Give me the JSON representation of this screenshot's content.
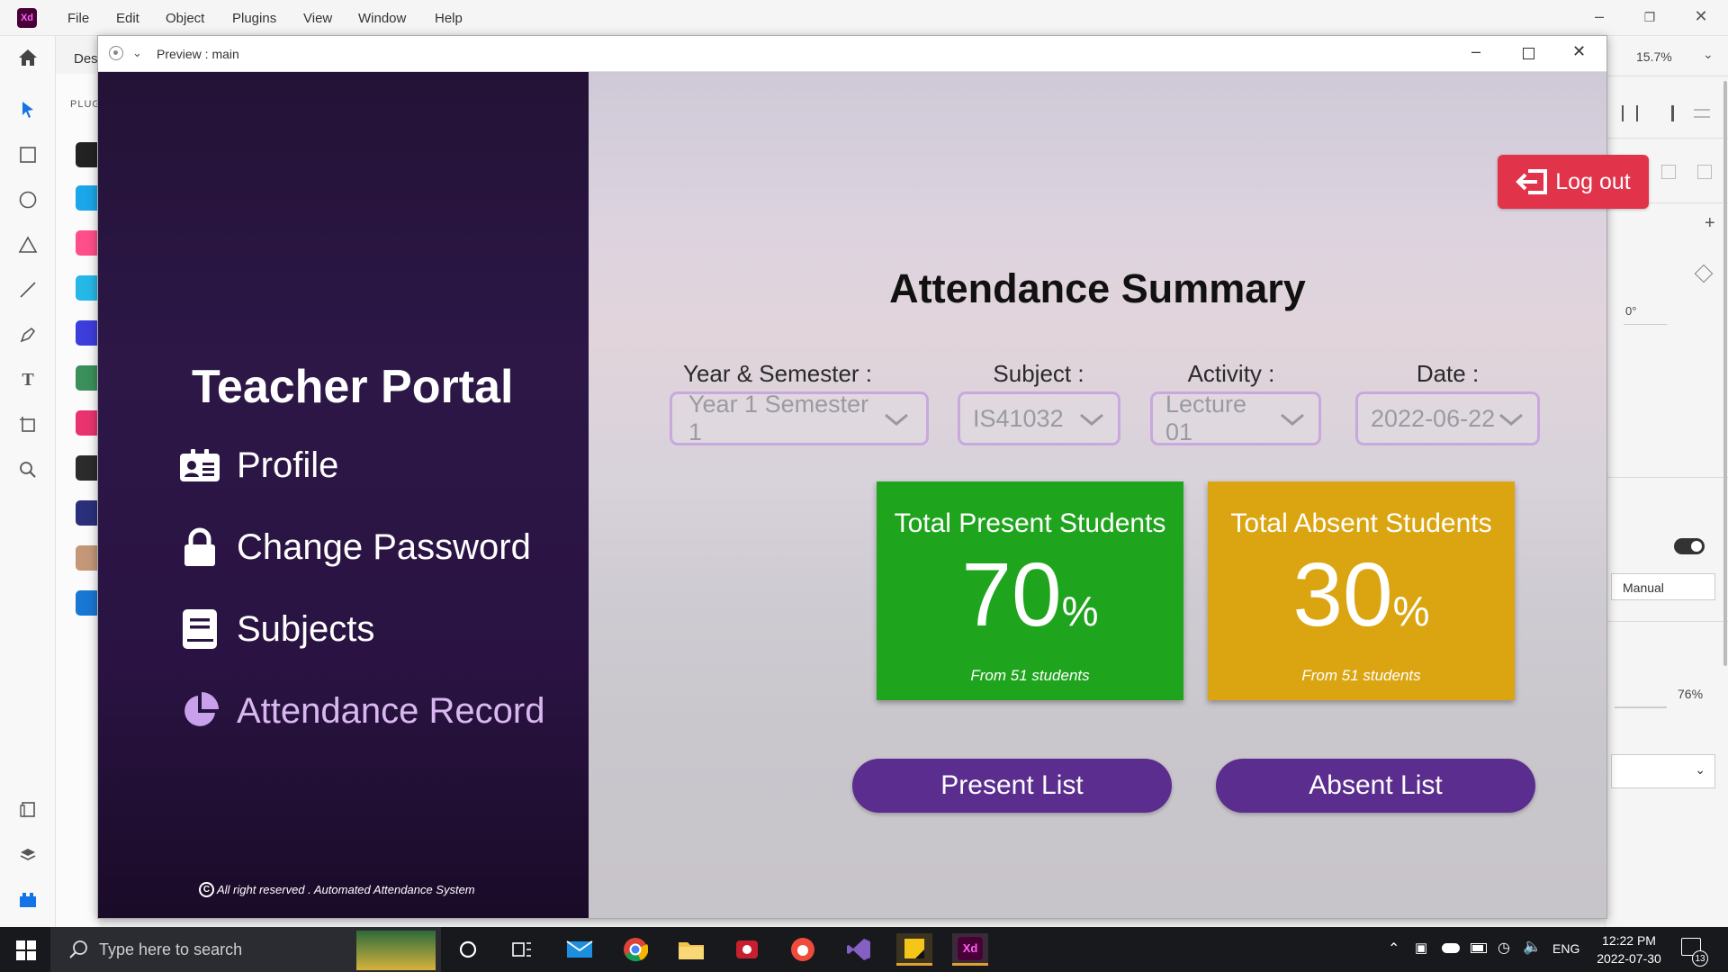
{
  "app": {
    "logo": "Xd",
    "menu": [
      "File",
      "Edit",
      "Object",
      "Plugins",
      "View",
      "Window",
      "Help"
    ],
    "doc_tab": "Des",
    "plugins_label": "PLUG",
    "zoom": "15.7%"
  },
  "right_panel": {
    "rotation": "0°",
    "dropdown_value": "Manual",
    "opacity": "76%"
  },
  "preview": {
    "title": "Preview : main",
    "portal_title": "Teacher Portal",
    "nav": [
      {
        "label": "Profile",
        "icon": "profile-card-icon"
      },
      {
        "label": "Change Password",
        "icon": "lock-icon"
      },
      {
        "label": "Subjects",
        "icon": "book-icon"
      },
      {
        "label": "Attendance Record",
        "icon": "pie-chart-icon"
      }
    ],
    "copyright": "All right reserved . Automated Attendance System",
    "logout_label": "Log out",
    "heading": "Attendance Summary",
    "filters": [
      {
        "label": "Year & Semester :",
        "value": "Year 1 Semester 1"
      },
      {
        "label": "Subject :",
        "value": "IS41032"
      },
      {
        "label": "Activity :",
        "value": "Lecture 01"
      },
      {
        "label": "Date :",
        "value": "2022-06-22"
      }
    ],
    "present_card": {
      "title": "Total Present Students",
      "value": "70",
      "unit": "%",
      "sub": "From 51 students",
      "color": "#1fa51d"
    },
    "absent_card": {
      "title": "Total Absent Students",
      "value": "30",
      "unit": "%",
      "sub": "From 51 students",
      "color": "#dba512"
    },
    "present_button": "Present List",
    "absent_button": "Absent List",
    "accent": "#5b2d8f",
    "logout_color": "#e1344a"
  },
  "taskbar": {
    "search_placeholder": "Type here to search",
    "lang": "ENG",
    "time": "12:22 PM",
    "date": "2022-07-30",
    "notifications": "13"
  }
}
